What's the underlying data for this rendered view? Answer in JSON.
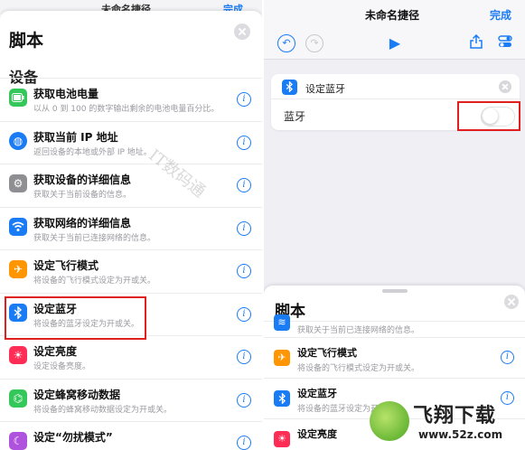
{
  "left": {
    "peek_title": "未命名捷径",
    "peek_done": "完成",
    "sheet_title": "脚本",
    "section_title": "设备",
    "watermark": "IT数码通",
    "items": [
      {
        "title": "获取电池电量",
        "desc": "以从 0 到 100 的数字输出剩余的电池电量百分比。",
        "icon": "battery-icon",
        "color": "#34c759"
      },
      {
        "title": "获取当前 IP 地址",
        "desc": "返回设备的本地或外部 IP 地址。",
        "icon": "globe-icon",
        "color": "#1a7cf5"
      },
      {
        "title": "获取设备的详细信息",
        "desc": "获取关于当前设备的信息。",
        "icon": "gear-icon",
        "color": "#8e8e93"
      },
      {
        "title": "获取网络的详细信息",
        "desc": "获取关于当前已连接网络的信息。",
        "icon": "wifi-icon",
        "color": "#1a7cf5"
      },
      {
        "title": "设定飞行模式",
        "desc": "将设备的飞行模式设定为开或关。",
        "icon": "airplane-icon",
        "color": "#ff9500"
      },
      {
        "title": "设定蓝牙",
        "desc": "将设备的蓝牙设定为开或关。",
        "icon": "bluetooth-icon",
        "color": "#1a7cf5"
      },
      {
        "title": "设定亮度",
        "desc": "设定设备亮度。",
        "icon": "sun-icon",
        "color": "#ff2d55"
      },
      {
        "title": "设定蜂窝移动数据",
        "desc": "将设备的蜂窝移动数据设定为开或关。",
        "icon": "antenna-icon",
        "color": "#34c759"
      },
      {
        "title": "设定“勿扰模式”",
        "desc": "",
        "icon": "moon-icon",
        "color": "#af52de"
      }
    ]
  },
  "right": {
    "title": "未命名捷径",
    "done": "完成",
    "card": {
      "title": "设定蓝牙",
      "label": "蓝牙",
      "toggle_on": false
    },
    "sheet_title": "脚本",
    "items": [
      {
        "title": "",
        "desc": "获取关于当前已连接网络的信息。",
        "icon": "wifi-icon",
        "color": "#1a7cf5"
      },
      {
        "title": "设定飞行模式",
        "desc": "将设备的飞行模式设定为开或关。",
        "icon": "airplane-icon",
        "color": "#ff9500"
      },
      {
        "title": "设定蓝牙",
        "desc": "将设备的蓝牙设定为开或关。",
        "icon": "bluetooth-icon",
        "color": "#1a7cf5"
      },
      {
        "title": "设定亮度",
        "desc": "",
        "icon": "sun-icon",
        "color": "#ff2d55"
      }
    ]
  },
  "logo": {
    "name": "飞翔下载",
    "url": "www.52z.com"
  }
}
